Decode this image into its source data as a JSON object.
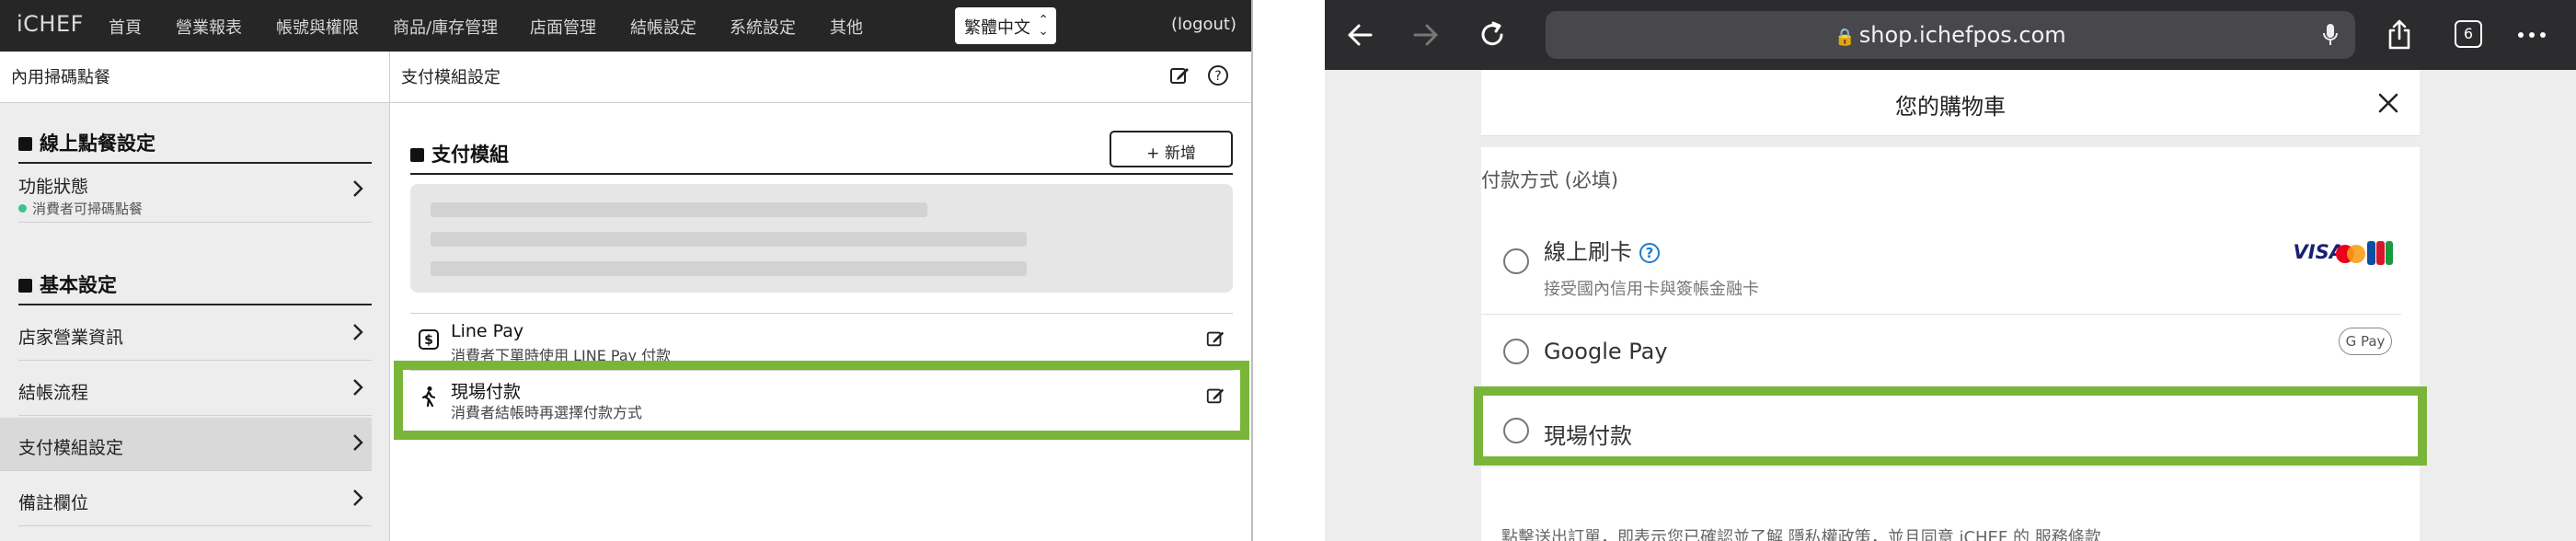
{
  "admin": {
    "logo": "iCHEF",
    "nav": [
      "首頁",
      "營業報表",
      "帳號與權限",
      "商品/庫存管理",
      "店面管理",
      "結帳設定",
      "系統設定",
      "其他"
    ],
    "language": "繁體中文",
    "logout": "(logout)",
    "sidebar_header": "內用掃碼點餐",
    "content_header": "支付模組設定",
    "sections": {
      "online": "線上點餐設定",
      "basic": "基本設定"
    },
    "function_status": {
      "label": "功能狀態",
      "sub": "消費者可掃碼點餐"
    },
    "sidebar_items": [
      {
        "label": "店家營業資訊"
      },
      {
        "label": "結帳流程"
      },
      {
        "label": "支付模組設定"
      },
      {
        "label": "備註欄位"
      }
    ],
    "payment_title": "支付模組",
    "add_button": "+ 新增",
    "payment_modules": [
      {
        "name": "Line Pay",
        "desc": "消費者下單時使用 LINE Pay 付款"
      },
      {
        "name": "現場付款",
        "desc": "消費者結帳時再選擇付款方式"
      }
    ]
  },
  "browser": {
    "url": "shop.ichefpos.com",
    "tab_count": "6"
  },
  "cart": {
    "title": "您的購物車",
    "payment_label": "付款方式 (必填)",
    "options": [
      {
        "label": "線上刷卡",
        "sub": "接受國內信用卡與簽帳金融卡"
      },
      {
        "label": "Google Pay",
        "badge": "G Pay"
      },
      {
        "label": "現場付款"
      }
    ],
    "card_brand_visa": "VISA",
    "footer": "點擊送出訂單，即表示您已確認並了解 隱私權政策，並且同意 iCHEF 的 服務條款"
  },
  "colors": {
    "highlight": "#7ab53a",
    "status_dot": "#3cc48a",
    "link_blue": "#1a7fd4"
  }
}
